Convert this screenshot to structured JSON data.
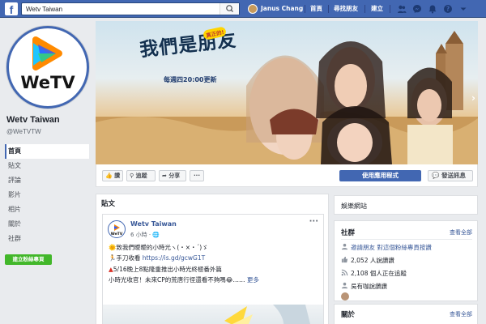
{
  "topbar": {
    "search_value": "Wetv Taiwan",
    "user_name": "Janus Chang",
    "nav_home": "首頁",
    "nav_find_friends": "尋找朋友",
    "nav_create": "建立"
  },
  "page": {
    "logo_text": "WeTV",
    "name": "Wetv Taiwan",
    "handle": "@WeTVTW"
  },
  "sidebar": {
    "items": [
      {
        "label": "首頁"
      },
      {
        "label": "貼文"
      },
      {
        "label": "評論"
      },
      {
        "label": "影片"
      },
      {
        "label": "相片"
      },
      {
        "label": "關於"
      },
      {
        "label": "社群"
      }
    ],
    "create_page_label": "建立粉絲專頁"
  },
  "cover": {
    "title": "我們是朋友",
    "badge": "真正的!",
    "subtitle": "每週四20:00更新"
  },
  "actions": {
    "like": "讚",
    "follow": "追蹤",
    "share": "分享",
    "more": "···",
    "use_app": "使用應用程式",
    "send_message": "發送訊息"
  },
  "posts": {
    "heading": "貼文",
    "author": "Wetv Taiwan",
    "time": "6 小時",
    "line1": "致我們曖曖的小時光ヽ(・×・´)ゞ",
    "line2_prefix": "手刀收看 ",
    "line2_link": "https://is.gd/gcwG1T",
    "line3": "5/16晚上8點隆重推出小時光終極番外篇",
    "line4": "小時光收官！未來CP的荒唐行徑還看不夠嗎😂…… ",
    "more_link": "更多"
  },
  "right": {
    "website_label": "娛樂網站",
    "community_title": "社群",
    "see_all": "查看全部",
    "invite": "邀請朋友 對這個粉絲專頁按讚",
    "likes": "2,052 人說讚讚",
    "follows": "2,108 個人正在追蹤",
    "friend": "吳有咖說讚讚",
    "about_title": "關於",
    "about_see_all": "查看全部"
  }
}
